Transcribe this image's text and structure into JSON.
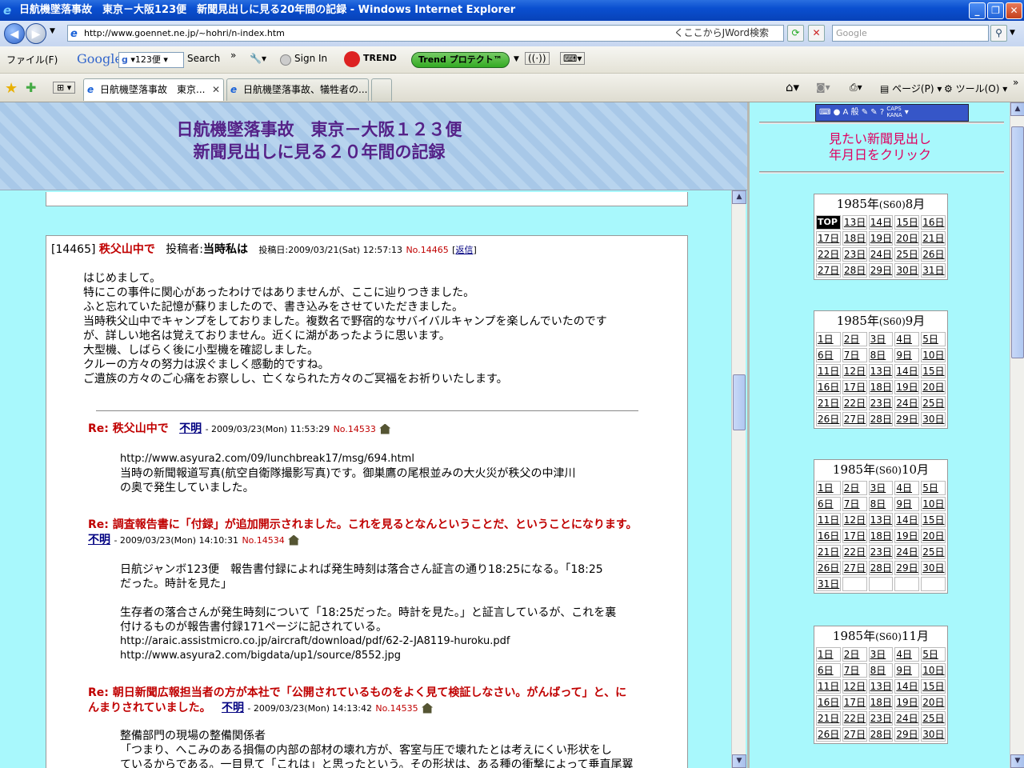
{
  "window": {
    "title": "日航機墜落事故　東京－大阪123便　新聞見出しに見る20年間の記録 - Windows Internet Explorer"
  },
  "address": {
    "url": "http://www.goennet.ne.jp/~hohri/n-index.htm",
    "jword": "くここからJWord検索",
    "search_placeholder": "Google"
  },
  "toolbar": {
    "file_menu": "ファイル(F)",
    "google": "Google",
    "google_query": "123便",
    "search": "Search",
    "signin": "Sign In",
    "trend": "TREND",
    "trend_protect": "Trend プロテクト™"
  },
  "tabs": [
    {
      "label": "日航機墜落事故　東京..."
    },
    {
      "label": "日航機墜落事故、犠牲者の..."
    }
  ],
  "command_bar": {
    "page": "ページ(P)",
    "tools": "ツール(O)"
  },
  "banner": {
    "line1": "日航機墜落事故　東京－大阪１２３便",
    "line2": "新聞見出しに見る２０年間の記録"
  },
  "post": {
    "id": "[14465]",
    "title": "秩父山中で",
    "author_label": "投稿者:",
    "author": "当時私は",
    "date": "投稿日:2009/03/21(Sat) 12:57:13",
    "no": "No.14465",
    "reply_open": "[",
    "reply": "返信",
    "reply_close": "]",
    "body": [
      "はじめまして。",
      "特にこの事件に関心があったわけではありませんが、ここに辿りつきました。",
      "ふと忘れていた記憶が蘇りましたので、書き込みをさせていただきました。",
      "当時秩父山中でキャンプをしておりました。複数名で野宿的なサバイバルキャンプを楽しんでいたのです",
      "が、詳しい地名は覚えておりません。近くに湖があったように思います。",
      "大型機、しばらく後に小型機を確認しました。",
      "クルーの方々の努力は涙ぐましく感動的ですね。",
      "ご遺族の方々のご心痛をお察しし、亡くなられた方々のご冥福をお祈りいたします。"
    ]
  },
  "replies": [
    {
      "title": "Re: 秩父山中で",
      "author": "不明",
      "date": "- 2009/03/23(Mon) 11:53:29",
      "no": "No.14533",
      "body": [
        "http://www.asyura2.com/09/lunchbreak17/msg/694.html",
        "当時の新聞報道写真(航空自衛隊撮影写真)です。御巣鷹の尾根並みの大火災が秩父の中津川",
        "の奥で発生していました。"
      ]
    },
    {
      "title": "Re: 調査報告書に「付録」が追加開示されました。これを見るとなんということだ、ということになります。",
      "author": "不明",
      "date": "- 2009/03/23(Mon) 14:10:31",
      "no": "No.14534",
      "body": [
        "日航ジャンボ123便　報告書付録によれば発生時刻は落合さん証言の通り18:25になる。「18:25",
        "だった。時計を見た」",
        "",
        "生存者の落合さんが発生時刻について「18:25だった。時計を見た。」と証言しているが、これを裏",
        "付けるものが報告書付録171ページに記されている。",
        "http://araic.assistmicro.co.jp/aircraft/download/pdf/62-2-JA8119-huroku.pdf",
        "http://www.asyura2.com/bigdata/up1/source/8552.jpg"
      ]
    },
    {
      "title1": "Re: 朝日新聞広報担当者の方が本社で「公開されているものをよく見て検証しなさい。がんばって」と、に",
      "title2": "んまりされていました。",
      "author": "不明",
      "date": "- 2009/03/23(Mon) 14:13:42",
      "no": "No.14535",
      "body": [
        "整備部門の現場の整備関係者",
        "「つまり、へこみのある損傷の内部の部材の壊れ方が、客室与圧で壊れたとは考えにくい形状をし",
        "ているからである。一目見て「これは」と思ったという。その形状は、ある種の衝撃によって垂直尾翼"
      ]
    }
  ],
  "right": {
    "langbar": "A 般",
    "caps": "CAPS",
    "kana": "KANA",
    "title1": "見たい新聞見出し",
    "title2": "年月日をクリック"
  },
  "calendars": [
    {
      "year": "1985年",
      "era": "(S60)",
      "month": "8月",
      "days": [
        "TOP",
        "13日",
        "14日",
        "15日",
        "16日",
        "17日",
        "18日",
        "19日",
        "20日",
        "21日",
        "22日",
        "23日",
        "24日",
        "25日",
        "26日",
        "27日",
        "28日",
        "29日",
        "30日",
        "31日"
      ]
    },
    {
      "year": "1985年",
      "era": "(S60)",
      "month": "9月",
      "days": [
        "1日",
        "2日",
        "3日",
        "4日",
        "5日",
        "6日",
        "7日",
        "8日",
        "9日",
        "10日",
        "11日",
        "12日",
        "13日",
        "14日",
        "15日",
        "16日",
        "17日",
        "18日",
        "19日",
        "20日",
        "21日",
        "22日",
        "23日",
        "24日",
        "25日",
        "26日",
        "27日",
        "28日",
        "29日",
        "30日"
      ]
    },
    {
      "year": "1985年",
      "era": "(S60)",
      "month": "10月",
      "days": [
        "1日",
        "2日",
        "3日",
        "4日",
        "5日",
        "6日",
        "7日",
        "8日",
        "9日",
        "10日",
        "11日",
        "12日",
        "13日",
        "14日",
        "15日",
        "16日",
        "17日",
        "18日",
        "19日",
        "20日",
        "21日",
        "22日",
        "23日",
        "24日",
        "25日",
        "26日",
        "27日",
        "28日",
        "29日",
        "30日",
        "31日",
        "",
        "",
        "",
        ""
      ]
    },
    {
      "year": "1985年",
      "era": "(S60)",
      "month": "11月",
      "days": [
        "1日",
        "2日",
        "3日",
        "4日",
        "5日",
        "6日",
        "7日",
        "8日",
        "9日",
        "10日",
        "11日",
        "12日",
        "13日",
        "14日",
        "15日",
        "16日",
        "17日",
        "18日",
        "19日",
        "20日",
        "21日",
        "22日",
        "23日",
        "24日",
        "25日",
        "26日",
        "27日",
        "28日",
        "29日",
        "30日"
      ]
    }
  ]
}
